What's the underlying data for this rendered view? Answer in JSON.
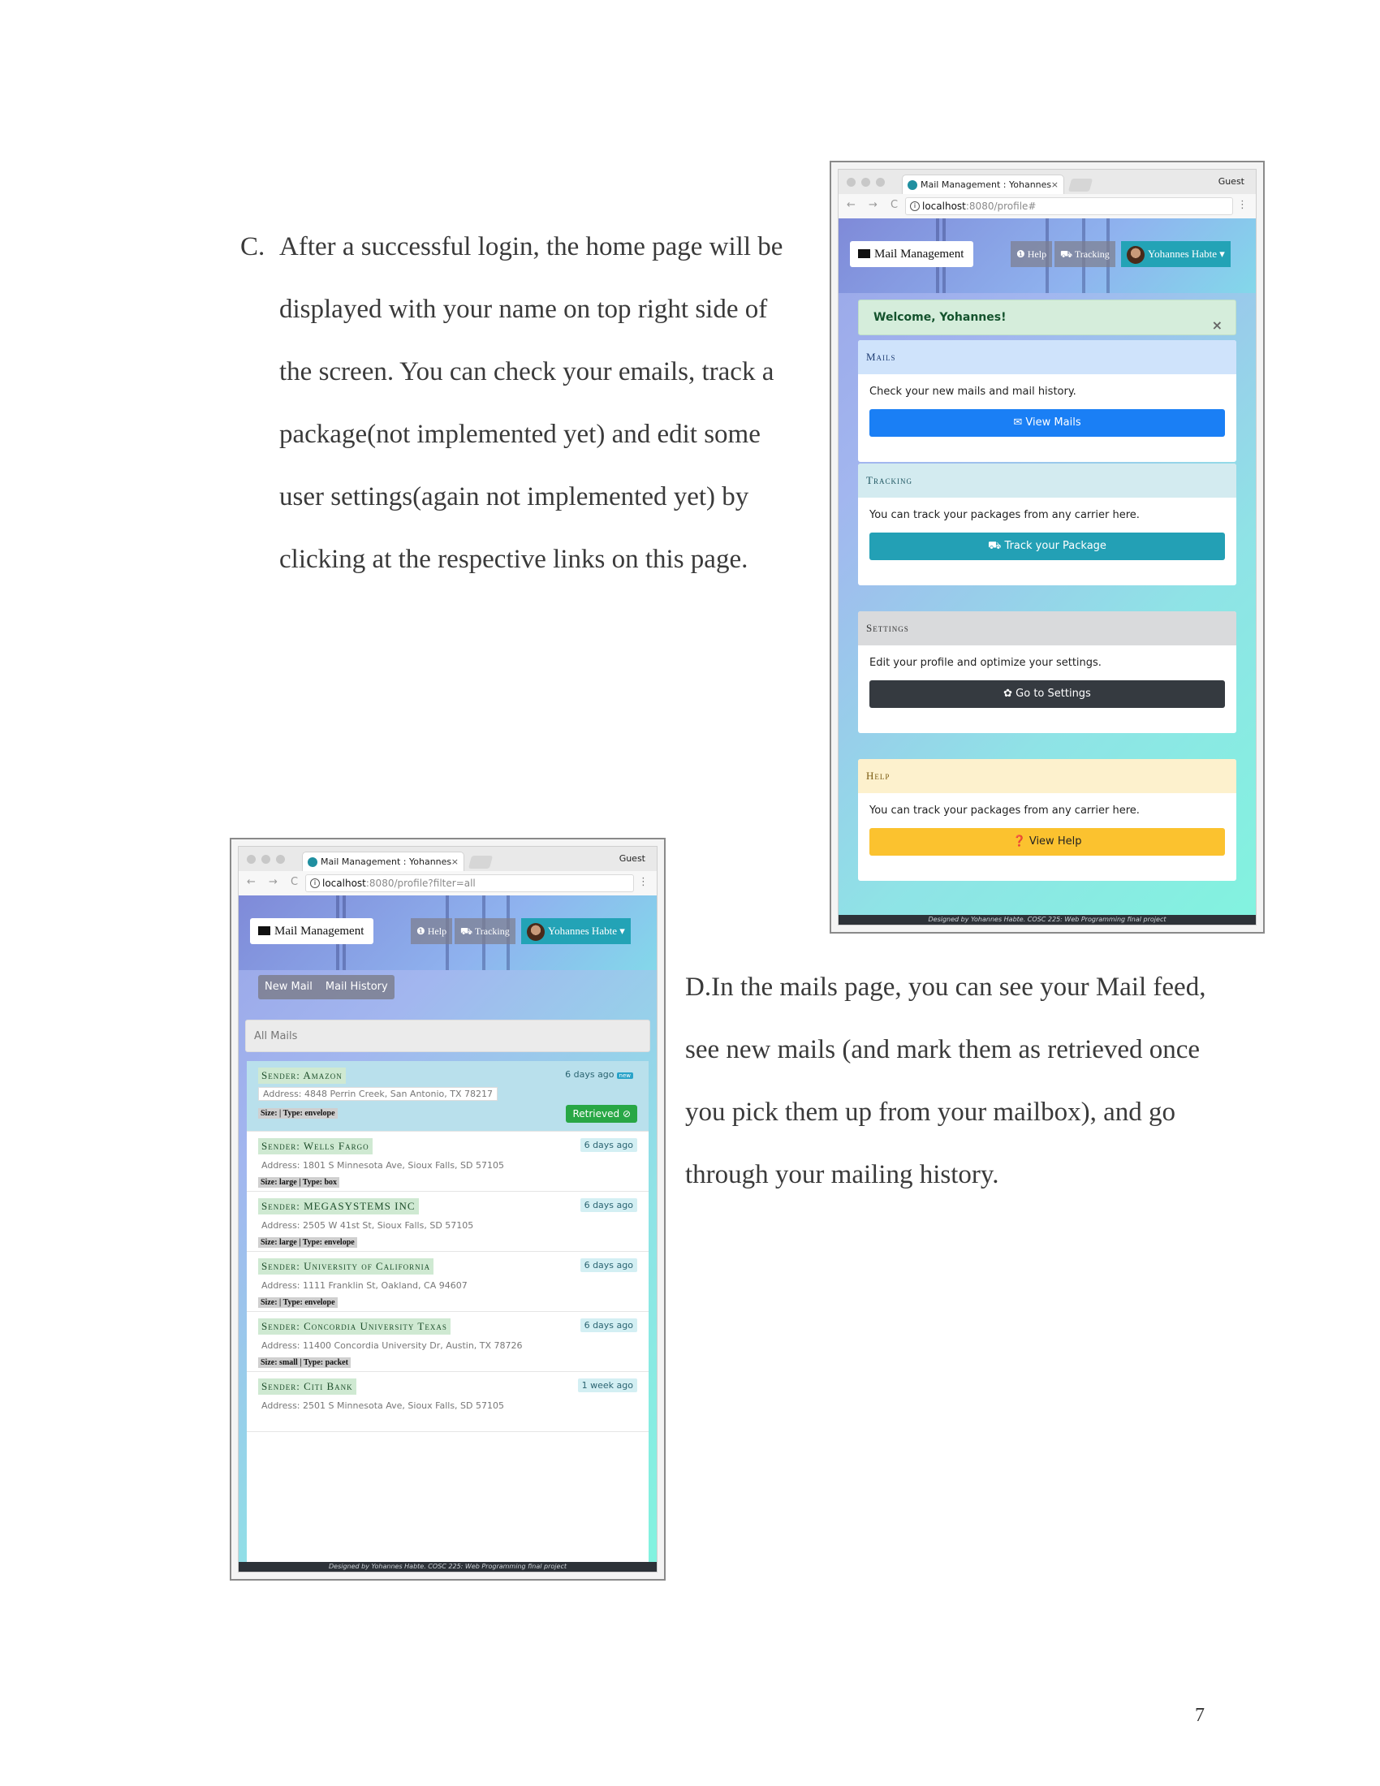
{
  "page_number": "7",
  "section_c": {
    "marker": "C.",
    "lines": [
      "After a successful login, the home page will be",
      "displayed with your name on top right side of",
      "the screen. You can check your emails, track a",
      "package(not implemented yet)  and edit some",
      "user settings(again not implemented yet)  by",
      "clicking at the respective links on this page."
    ]
  },
  "section_d": {
    "lines": [
      "D.In the mails page, you can see your Mail feed,",
      "see new mails (and mark them as retrieved once",
      "you pick them up from your mailbox), and go",
      "through your mailing history."
    ]
  },
  "home_shot": {
    "tab_title": "Mail Management : Yohannes",
    "tab_close": "×",
    "guest": "Guest",
    "nav_arrows": "← → C",
    "url_host": "localhost",
    "url_rest": ":8080/profile#",
    "kebab": "⋮",
    "brand": "Mail Management",
    "help": "❶ Help",
    "tracking": "⛟ Tracking",
    "user": "Yohannes Habte ▾",
    "alert": "Welcome, Yohannes!",
    "alert_close": "×",
    "cards": [
      {
        "header": "Mails",
        "text": "Check your new mails and mail history.",
        "button": "✉ View Mails",
        "hd_bg": "#cfe3fb",
        "hd_color": "#1f3d73",
        "btn_bg": "#1a7ff5"
      },
      {
        "header": "Tracking",
        "text": "You can track your packages from any carrier here.",
        "button": "⛟ Track your Package",
        "hd_bg": "#d3ebf0",
        "hd_color": "#1d5560",
        "btn_bg": "#23a0b5"
      },
      {
        "header": "Settings",
        "text": "Edit your profile and optimize your settings.",
        "button": "✿ Go to Settings",
        "hd_bg": "#d9dadc",
        "hd_color": "#333",
        "btn_bg": "#353a40"
      },
      {
        "header": "Help",
        "text": "You can track your packages from any carrier here.",
        "button": "❓ View Help",
        "hd_bg": "#fdf1cd",
        "hd_color": "#7a5a10",
        "btn_bg": "#fbc22f",
        "btn_color": "#222"
      }
    ],
    "footer": "Designed by Yohannes Habte. COSC 225: Web Programming final project"
  },
  "mails_shot": {
    "tab_title": "Mail Management : Yohannes",
    "tab_close": "×",
    "guest": "Guest",
    "nav_arrows": "← → C",
    "url_host": "localhost",
    "url_rest": ":8080/profile?filter=all",
    "kebab": "⋮",
    "brand": "Mail Management",
    "help": "❶ Help",
    "tracking": "⛟ Tracking",
    "user": "Yohannes Habte ▾",
    "subnav": [
      "New Mail",
      "Mail History"
    ],
    "list_header": "All Mails",
    "new_badge": "new",
    "retrieved": "Retrieved ⊘",
    "mails": [
      {
        "sender": "Sender: Amazon",
        "when": "6 days ago",
        "address": "Address: 4848 Perrin Creek, San Antonio, TX 78217",
        "tags": "Size: | Type: envelope"
      },
      {
        "sender": "Sender: Wells Fargo",
        "when": "6 days ago",
        "address": "Address: 1801 S Minnesota Ave, Sioux Falls, SD 57105",
        "tags": "Size: large | Type: box"
      },
      {
        "sender": "Sender: MEGASYSTEMS INC",
        "when": "6 days ago",
        "address": "Address: 2505 W 41st St, Sioux Falls, SD 57105",
        "tags": "Size: large | Type: envelope"
      },
      {
        "sender": "Sender: University of California",
        "when": "6 days ago",
        "address": "Address: 1111 Franklin St, Oakland, CA 94607",
        "tags": "Size: | Type: envelope"
      },
      {
        "sender": "Sender: Concordia University Texas",
        "when": "6 days ago",
        "address": "Address: 11400 Concordia University Dr, Austin, TX 78726",
        "tags": "Size: small | Type: packet"
      },
      {
        "sender": "Sender: Citi Bank",
        "when": "1 week ago",
        "address": "Address: 2501 S Minnesota Ave, Sioux Falls, SD 57105",
        "tags": ""
      }
    ],
    "footer": "Designed by Yohannes Habte. COSC 225: Web Programming final project"
  }
}
